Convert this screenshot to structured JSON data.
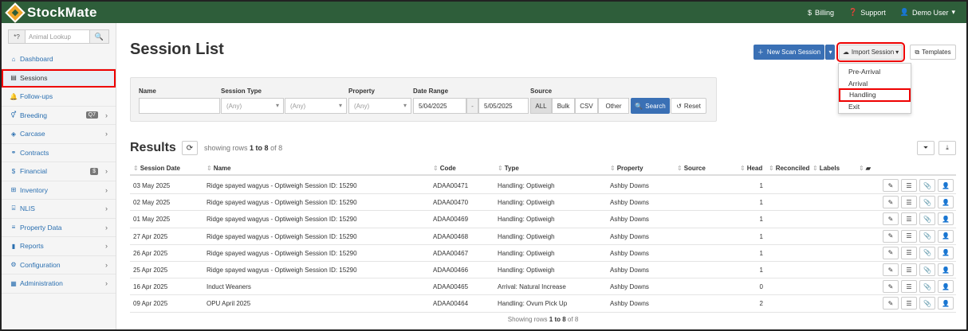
{
  "app": {
    "name": "StockMate"
  },
  "topnav": {
    "billing": "Billing",
    "support": "Support",
    "user": "Demo User"
  },
  "sidebar": {
    "lookup_prefix": "*?",
    "lookup_placeholder": "Animal Lookup",
    "items": [
      {
        "label": "Dashboard",
        "icon": "home-icon"
      },
      {
        "label": "Sessions",
        "icon": "list-icon"
      },
      {
        "label": "Follow-ups",
        "icon": "bell-icon"
      },
      {
        "label": "Breeding",
        "icon": "venus-mars-icon",
        "badge": "Q7"
      },
      {
        "label": "Carcase",
        "icon": "tag-icon"
      },
      {
        "label": "Contracts",
        "icon": "handshake-icon"
      },
      {
        "label": "Financial",
        "icon": "dollar-icon",
        "badge": "$"
      },
      {
        "label": "Inventory",
        "icon": "sitemap-icon"
      },
      {
        "label": "NLIS",
        "icon": "building-icon"
      },
      {
        "label": "Property Data",
        "icon": "sliders-icon"
      },
      {
        "label": "Reports",
        "icon": "bar-chart-icon"
      },
      {
        "label": "Configuration",
        "icon": "cog-icon"
      },
      {
        "label": "Administration",
        "icon": "admin-icon"
      }
    ]
  },
  "page": {
    "title": "Session List"
  },
  "buttons": {
    "new_scan": "New Scan Session",
    "import": "Import Session",
    "templates": "Templates"
  },
  "import_menu": [
    "Pre-Arrival",
    "Arrival",
    "Handling",
    "Exit"
  ],
  "filters": {
    "name_label": "Name",
    "session_type_label": "Session Type",
    "property_label": "Property",
    "date_range_label": "Date Range",
    "source_label": "Source",
    "any": "(Any)",
    "date_from": "5/04/2025",
    "date_sep": "-",
    "date_to": "5/05/2025",
    "sources": [
      "ALL",
      "Bulk",
      "CSV",
      "Other"
    ],
    "search": "Search",
    "reset": "Reset"
  },
  "results": {
    "title": "Results",
    "showing_prefix": "showing rows",
    "range": "1 to 8",
    "of": "of 8",
    "columns": [
      "Session Date",
      "Name",
      "Code",
      "Type",
      "Property",
      "Source",
      "Head",
      "Reconciled",
      "Labels"
    ],
    "rows": [
      {
        "date": "03 May 2025",
        "name": "Ridge spayed wagyus - Optiweigh Session ID: 15290",
        "code": "ADAA00471",
        "type": "Handling: Optiweigh",
        "property": "Ashby Downs",
        "head": "1"
      },
      {
        "date": "02 May 2025",
        "name": "Ridge spayed wagyus - Optiweigh Session ID: 15290",
        "code": "ADAA00470",
        "type": "Handling: Optiweigh",
        "property": "Ashby Downs",
        "head": "1"
      },
      {
        "date": "01 May 2025",
        "name": "Ridge spayed wagyus - Optiweigh Session ID: 15290",
        "code": "ADAA00469",
        "type": "Handling: Optiweigh",
        "property": "Ashby Downs",
        "head": "1"
      },
      {
        "date": "27 Apr 2025",
        "name": "Ridge spayed wagyus - Optiweigh Session ID: 15290",
        "code": "ADAA00468",
        "type": "Handling: Optiweigh",
        "property": "Ashby Downs",
        "head": "1"
      },
      {
        "date": "26 Apr 2025",
        "name": "Ridge spayed wagyus - Optiweigh Session ID: 15290",
        "code": "ADAA00467",
        "type": "Handling: Optiweigh",
        "property": "Ashby Downs",
        "head": "1"
      },
      {
        "date": "25 Apr 2025",
        "name": "Ridge spayed wagyus - Optiweigh Session ID: 15290",
        "code": "ADAA00466",
        "type": "Handling: Optiweigh",
        "property": "Ashby Downs",
        "head": "1"
      },
      {
        "date": "16 Apr 2025",
        "name": "Induct Weaners",
        "code": "ADAA00465",
        "type": "Arrival: Natural Increase",
        "property": "Ashby Downs",
        "head": "0"
      },
      {
        "date": "09 Apr 2025",
        "name": "OPU April 2025",
        "code": "ADAA00464",
        "type": "Handling: Ovum Pick Up",
        "property": "Ashby Downs",
        "head": "2"
      }
    ],
    "footer_prefix": "Showing rows",
    "footer_range": "1 to 8",
    "footer_of": "of 8"
  },
  "colors": {
    "topbar": "#2e5e3a",
    "primary": "#3a70b5",
    "highlight": "#e00000",
    "link": "#2a6fb0"
  }
}
